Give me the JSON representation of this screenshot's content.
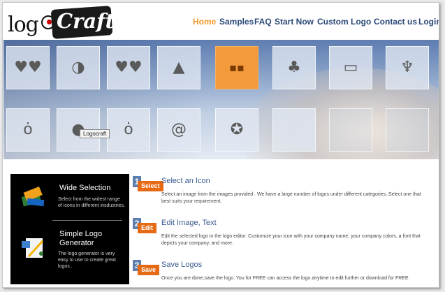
{
  "logo": {
    "part1": "log",
    "part2": "Craft"
  },
  "nav": [
    {
      "label": "Home",
      "active": true
    },
    {
      "label": "Samples",
      "active": false
    },
    {
      "label": "FAQ",
      "active": false
    },
    {
      "label": "Start Now",
      "active": false
    },
    {
      "label": "Custom Logo",
      "active": false
    },
    {
      "label": "Contact us",
      "active": false
    },
    {
      "label": "Login",
      "active": false
    }
  ],
  "banner": {
    "tooltip": "Logocraft",
    "tiles_row1": [
      "hearts-icon",
      "abstract-figure-icon",
      "hearts-icon",
      "triangle-icon",
      "squares-icon",
      "leaf-icon",
      "computer-icon",
      "sprout-icon"
    ],
    "tiles_row2": [
      "apple-icon",
      "bubbles-icon",
      "apple-icon",
      "swirl-icon",
      "star-circle-icon",
      "empty",
      "empty",
      "empty"
    ]
  },
  "panel": {
    "section1": {
      "title": "Wide Selection",
      "desc": "Select from the widest range of icons in different insdustries."
    },
    "section2": {
      "title": "Simple Logo Generator",
      "desc": "The logo generator is very easy to use to create great logos ."
    }
  },
  "steps": [
    {
      "num": "1",
      "badge": "Select",
      "title": "Select an Icon",
      "desc": "Select an image from the images provided . We have a large number of logos under different categories..Select one that best suits your requirement."
    },
    {
      "num": "2",
      "badge": "Edit",
      "title": "Edit Image, Text",
      "desc": "Edit the selected logo in the logo editor. Customize your icon with your company name, your company colors, a font that depicts your company, and more."
    },
    {
      "num": "3",
      "badge": "Save",
      "title": "Save Logos",
      "desc": "Once you are done,save the logo. You for FREE can access the logo anytime to edit further or download for FREE"
    }
  ]
}
